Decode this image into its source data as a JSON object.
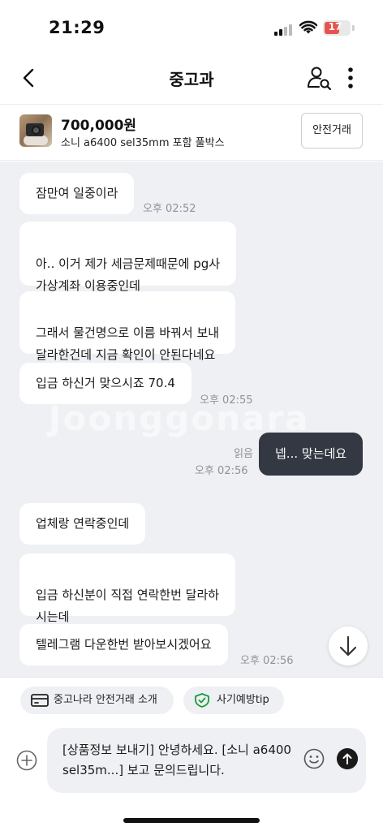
{
  "status_bar": {
    "time": "21:29",
    "battery": "17",
    "battery_color": "#e6534e"
  },
  "nav": {
    "title": "중고과",
    "back_icon": "chevron-left-icon",
    "profile_icon": "user-search-icon",
    "more_icon": "more-vertical-icon"
  },
  "product": {
    "price": "700,000원",
    "name": "소니 a6400 sel35mm 포함 풀박스",
    "safe_trade_label": "안전거래"
  },
  "chat": {
    "watermark": "Joonggonara",
    "messages": [
      {
        "text": "잠만여 일중이라",
        "time": "오후 02:52"
      },
      {
        "text": "아.. 이거 제가 세금문제때문에 pg사\n가상계좌 이용중인데"
      },
      {
        "text": "그래서 물건명으로 이름 바꿔서 보내\n달라한건데 지금 확인이 안된다네요"
      },
      {
        "text": "입금 하신거 맞으시죠 70.4",
        "time": "오후 02:55"
      },
      {
        "text": "넵... 맞는데요",
        "read": "읽음",
        "time": "오후 02:56",
        "mine": true
      },
      {
        "text": "업체랑 연락중인데"
      },
      {
        "text": "입금 하신분이 직접 연락한번 달라하\n시는데"
      },
      {
        "text": "텔레그램 다운한번 받아보시겠어요",
        "time": "오후 02:56"
      }
    ],
    "bubble_colors": {
      "theirs": "#ffffff",
      "mine": "#333842"
    }
  },
  "quick_actions": [
    {
      "label": "중고나라 안전거래 소개",
      "icon": "card-icon"
    },
    {
      "label": "사기예방tip",
      "icon": "shield-icon"
    }
  ],
  "composer": {
    "text": "[상품정보 보내기] 안녕하세요. [소니 a6400 sel35m...] 보고 문의드립니다."
  }
}
